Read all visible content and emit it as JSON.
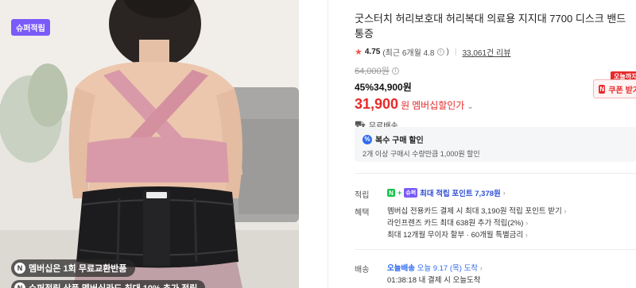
{
  "image": {
    "super_badge": "슈퍼적립",
    "membership_badge": "멤버십은 1회 무료교환반품",
    "membership_badge2": "슈퍼적립 상품 멤버십라도 최대 10% 추가 적립",
    "colors": {
      "top": "#d89aa8",
      "belt": "#1c1c1e",
      "bg": "#e9e6e2"
    }
  },
  "product": {
    "title": "굿스터치 허리보호대 허리복대 의료용 지지대 7700 디스크 밴드 통증",
    "rating": "4.75",
    "rating_detail": "(최근 6개월 4.8",
    "reviews": "33,061건 리뷰",
    "original_price": "64,000원",
    "discount_line": "45%34,900원",
    "member_price": "31,900",
    "member_unit": "원",
    "member_label": "멤버십할인가",
    "shipping": "무료배송"
  },
  "coupon": {
    "today_tag": "오늘까지",
    "label": "쿠폰 받기"
  },
  "multi_purchase": {
    "title": "복수 구매 할인",
    "desc": "2개 이상 구매시 수량만큼 1,000원 할인"
  },
  "benefits": {
    "points_label": "적립",
    "points_text": "최대 적립 포인트 7,378원",
    "super_chip": "슈퍼",
    "perks_label": "혜택",
    "perk1": "멤버십 전용카드 결제 시 최대 3,190원 적립 포인트 받기",
    "perk2": "라인프렌즈 카드 최대 638원 추가 적립(2%)",
    "perk3": "최대 12개월 무이자 할부 · 60개월 특별금리",
    "delivery_label": "배송",
    "today_delivery": "오늘배송",
    "delivery_date": "오늘 9.17 (목) 도착",
    "delivery_time": "01:38:18 내 결제 시 오늘도착"
  }
}
